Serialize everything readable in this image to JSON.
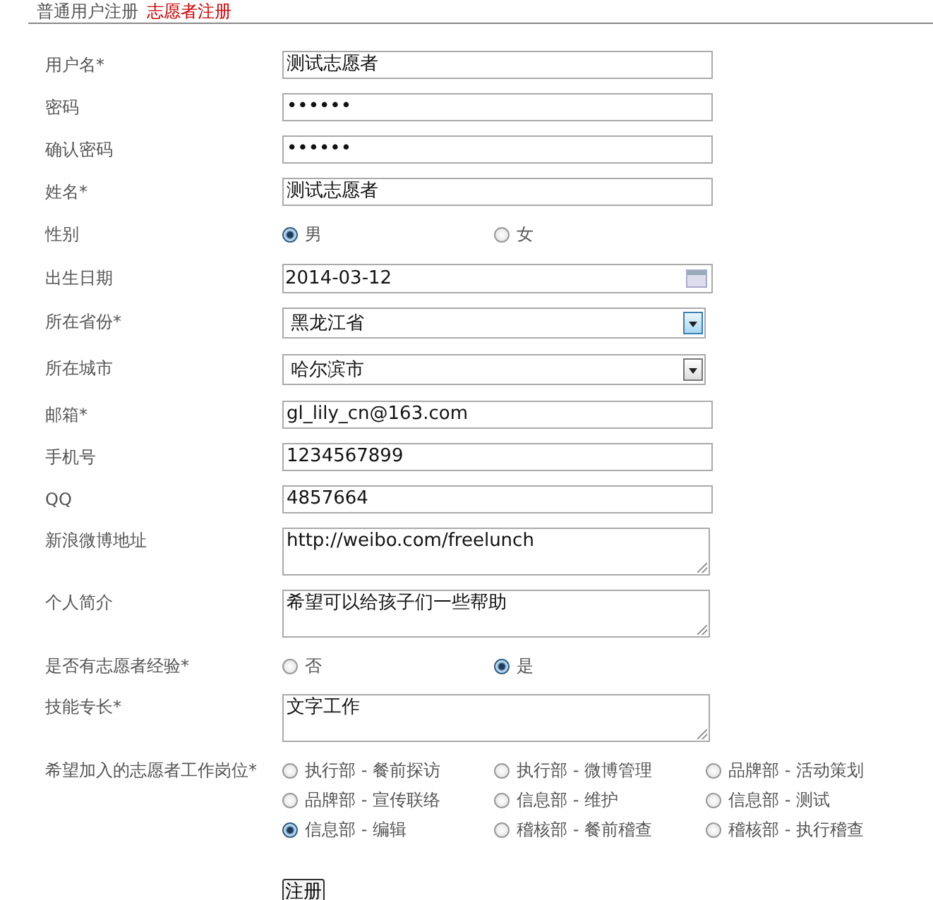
{
  "tabs": [
    {
      "label": "普通用户注册",
      "selected": false
    },
    {
      "label": "志愿者注册",
      "selected": true
    }
  ],
  "fields": [
    {
      "kind": "text",
      "label": "用户名*",
      "value": "测试志愿者"
    },
    {
      "kind": "text",
      "label": "密码",
      "value": "••••••"
    },
    {
      "kind": "text",
      "label": "确认密码",
      "value": "••••••"
    },
    {
      "kind": "text",
      "label": "姓名*",
      "value": "测试志愿者"
    },
    {
      "kind": "radio",
      "label": "性别",
      "options": [
        {
          "label": "男",
          "selected": true
        },
        {
          "label": "女",
          "selected": false
        }
      ]
    },
    {
      "kind": "date",
      "label": "出生日期",
      "value": "2014-03-12"
    },
    {
      "kind": "select",
      "label": "所在省份*",
      "value": "黑龙江省",
      "highlighted": true
    },
    {
      "kind": "select",
      "label": "所在城市",
      "value": "哈尔滨市",
      "highlighted": false
    },
    {
      "kind": "text",
      "label": "邮箱*",
      "value": "gl_lily_cn@163.com"
    },
    {
      "kind": "text",
      "label": "手机号",
      "value": "1234567899"
    },
    {
      "kind": "text",
      "label": "QQ",
      "value": "4857664"
    },
    {
      "kind": "textarea",
      "label": "新浪微博地址",
      "value": "http://weibo.com/freelunch"
    },
    {
      "kind": "textarea",
      "label": "个人简介",
      "value": "希望可以给孩子们一些帮助"
    },
    {
      "kind": "radio",
      "label": "是否有志愿者经验*",
      "options": [
        {
          "label": "否",
          "selected": false
        },
        {
          "label": "是",
          "selected": true
        }
      ]
    },
    {
      "kind": "textarea",
      "label": "技能专长*",
      "value": "文字工作"
    },
    {
      "kind": "grid",
      "label": "希望加入的志愿者工作岗位*",
      "options": [
        {
          "label": "执行部 - 餐前探访",
          "selected": false
        },
        {
          "label": "执行部 - 微博管理",
          "selected": false
        },
        {
          "label": "品牌部 - 活动策划",
          "selected": false
        },
        {
          "label": "品牌部 - 宣传联络",
          "selected": false
        },
        {
          "label": "信息部 - 维护",
          "selected": false
        },
        {
          "label": "信息部 - 测试",
          "selected": false
        },
        {
          "label": "信息部 - 编辑",
          "selected": true
        },
        {
          "label": "稽核部 - 餐前稽查",
          "selected": false
        },
        {
          "label": "稽核部 - 执行稽查",
          "selected": false
        }
      ]
    }
  ],
  "submit": "注册"
}
